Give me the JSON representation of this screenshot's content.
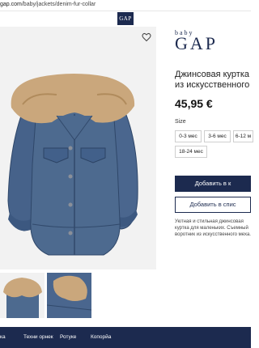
{
  "browser": {
    "url_host": "gap.com",
    "url_path": "/baby/jackets/denim-fur-collar"
  },
  "header": {
    "logo": "GAP"
  },
  "brand": {
    "baby": "baby",
    "gap": "GAP"
  },
  "product": {
    "title_line1": "Джинсовая куртка",
    "title_line2": "из искусственного",
    "price": "45,95 €",
    "size_label": "Size",
    "sizes": [
      "0-3 мес",
      "3-6 мес",
      "6-12 м",
      "18-24 мес"
    ],
    "add_to_cart": "Добавить в к",
    "add_to_wishlist": "Добавить в спис",
    "description": "Уютная и стильная джинсовая куртка для маленьких. Съемный воротник из искусственного меха."
  },
  "footer": {
    "items": [
      "ка",
      "Техни орнек",
      "Ротуке",
      "Копорйа"
    ]
  },
  "colors": {
    "navy": "#1c2a4f",
    "denim": "#4d6a8f",
    "fur": "#caa77c"
  },
  "icons": {
    "favorite": "heart-outline-icon"
  }
}
